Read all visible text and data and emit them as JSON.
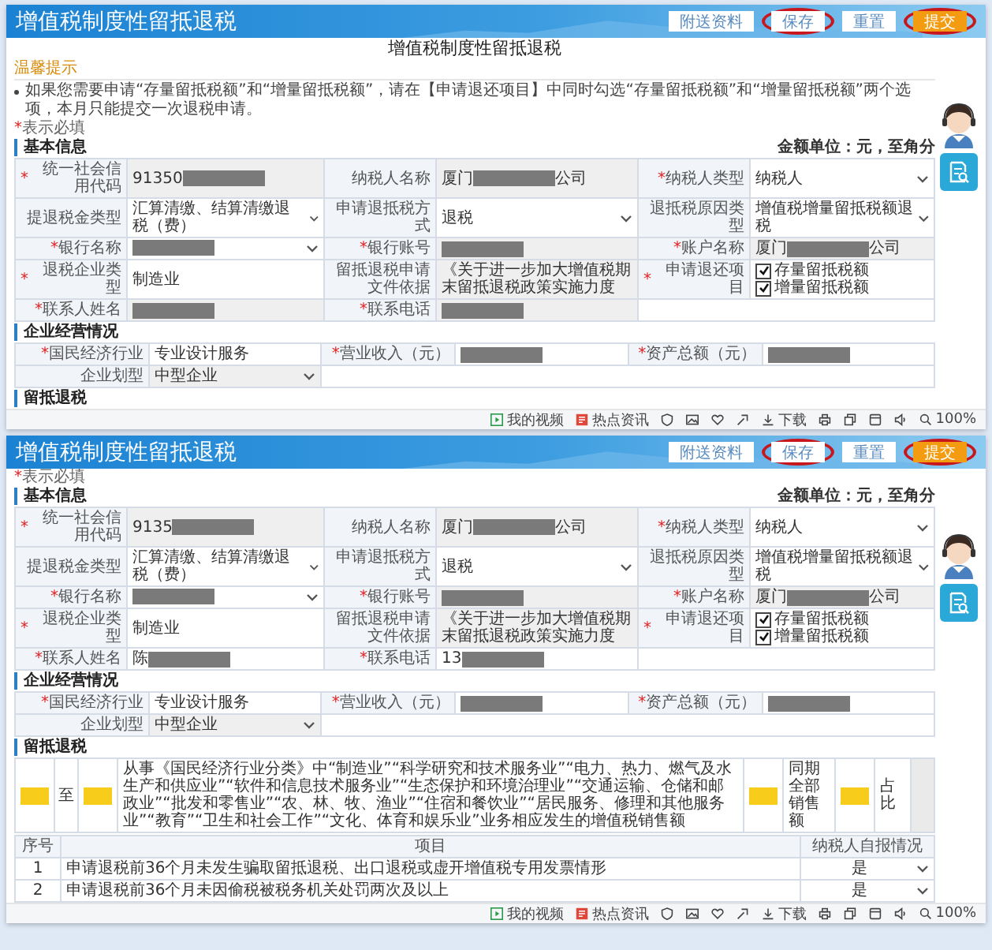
{
  "panels": [
    {
      "header": {
        "title": "增值税制度性留抵退税",
        "buttons": [
          {
            "label": "附送资料",
            "kind": "plain",
            "circled": false
          },
          {
            "label": "保存",
            "kind": "plain",
            "circled": true
          },
          {
            "label": "重置",
            "kind": "plain",
            "circled": false
          },
          {
            "label": "提交",
            "kind": "primary",
            "circled": true
          }
        ]
      },
      "page_title": "增值税制度性留抵退税",
      "tip": {
        "title": "温馨提示",
        "text": "如果您需要申请“存量留抵税额”和“增量留抵税额”，请在【申请退还项目】中同时勾选“存量留抵税额”和“增量留抵税额”两个选项，本月只能提交一次退税申请。"
      },
      "required_note": {
        "mark": "*",
        "text": "表示必填"
      },
      "sections": [
        {
          "title": "基本信息",
          "unit": "金额单位：元，至角分",
          "kind": "basic",
          "rows": [
            {
              "cells": [
                {
                  "kind": "label",
                  "required_mark": "*",
                  "text": "统一社会信用代码"
                },
                {
                  "kind": "input",
                  "text": "91350",
                  "redacted": true,
                  "disabled": true
                },
                {
                  "kind": "label",
                  "text": "纳税人名称"
                },
                {
                  "kind": "input",
                  "text": "厦门",
                  "redacted": true,
                  "suffix": "公司",
                  "disabled": true
                },
                {
                  "kind": "label",
                  "required_mark": "*",
                  "text": "纳税人类型"
                },
                {
                  "kind": "select",
                  "text": "纳税人"
                }
              ]
            },
            {
              "cells": [
                {
                  "kind": "label",
                  "text": "提退税金类型"
                },
                {
                  "kind": "select",
                  "text": "汇算清缴、结算清缴退税（费）"
                },
                {
                  "kind": "label",
                  "text": "申请退抵税方式"
                },
                {
                  "kind": "select",
                  "text": "退税"
                },
                {
                  "kind": "label",
                  "text": "退抵税原因类型"
                },
                {
                  "kind": "select",
                  "text": "增值税增量留抵税额退税"
                }
              ]
            },
            {
              "cells": [
                {
                  "kind": "label",
                  "required_mark": "*",
                  "text": "银行名称"
                },
                {
                  "kind": "select",
                  "redacted": true
                },
                {
                  "kind": "label",
                  "required_mark": "*",
                  "text": "银行账号"
                },
                {
                  "kind": "input",
                  "redacted": true,
                  "disabled": true
                },
                {
                  "kind": "label",
                  "required_mark": "*",
                  "text": "账户名称"
                },
                {
                  "kind": "input",
                  "text": "厦门",
                  "redacted": true,
                  "suffix": "公司",
                  "disabled": true
                }
              ]
            },
            {
              "cells": [
                {
                  "kind": "label",
                  "required_mark": "*",
                  "text": "退税企业类型"
                },
                {
                  "kind": "input",
                  "text": "制造业",
                  "disabled": false
                },
                {
                  "kind": "label",
                  "text": "留抵退税申请文件依据"
                },
                {
                  "kind": "input",
                  "text": "《关于进一步加大增值税期末留抵退税政策实施力度",
                  "disabled": true
                },
                {
                  "kind": "label",
                  "required_mark": "*",
                  "text": "申请退还项目"
                },
                {
                  "kind": "checks",
                  "options": [
                    {
                      "label": "存量留抵税额",
                      "checked": true
                    },
                    {
                      "label": "增量留抵税额",
                      "checked": true
                    }
                  ]
                }
              ]
            },
            {
              "cells": [
                {
                  "kind": "label",
                  "required_mark": "*",
                  "text": "联系人姓名"
                },
                {
                  "kind": "input",
                  "redacted": true,
                  "disabled": true
                },
                {
                  "kind": "label",
                  "required_mark": "*",
                  "text": "联系电话"
                },
                {
                  "kind": "input",
                  "redacted": true,
                  "disabled": true
                },
                {
                  "kind": "empty"
                }
              ]
            }
          ]
        },
        {
          "title": "企业经营情况",
          "kind": "business",
          "rows": [
            {
              "cells": [
                {
                  "kind": "label",
                  "required_mark": "*",
                  "text": "国民经济行业"
                },
                {
                  "kind": "input",
                  "text": "专业设计服务",
                  "disabled": false
                },
                {
                  "kind": "label",
                  "required_mark": "*",
                  "text": "营业收入（元）"
                },
                {
                  "kind": "input",
                  "redacted": true,
                  "disabled": false
                },
                {
                  "kind": "label",
                  "required_mark": "*",
                  "text": "资产总额（元）"
                },
                {
                  "kind": "input",
                  "redacted": true,
                  "disabled": false
                }
              ]
            },
            {
              "cells": [
                {
                  "kind": "label",
                  "text": "企业划型"
                },
                {
                  "kind": "select",
                  "text": "中型企业",
                  "disabled": true
                },
                {
                  "kind": "empty"
                }
              ]
            }
          ]
        },
        {
          "title": "留抵退税",
          "kind": "refund"
        }
      ],
      "status_bar": {
        "video": "我的视频",
        "news": "热点资讯",
        "download": "下载",
        "zoom": "100%"
      }
    },
    {
      "header": {
        "title": "增值税制度性留抵退税",
        "buttons": [
          {
            "label": "附送资料",
            "kind": "plain",
            "circled": false
          },
          {
            "label": "保存",
            "kind": "plain",
            "circled": true
          },
          {
            "label": "重置",
            "kind": "plain",
            "circled": false
          },
          {
            "label": "提交",
            "kind": "primary",
            "circled": true
          }
        ]
      },
      "required_note": {
        "mark": "*",
        "text": "表示必填"
      },
      "sections": [
        {
          "title": "基本信息",
          "unit": "金额单位：元，至角分",
          "kind": "basic",
          "rows": [
            {
              "cells": [
                {
                  "kind": "label",
                  "required_mark": "*",
                  "text": "统一社会信用代码"
                },
                {
                  "kind": "input",
                  "text": "9135",
                  "redacted": true,
                  "disabled": true
                },
                {
                  "kind": "label",
                  "text": "纳税人名称"
                },
                {
                  "kind": "input",
                  "text": "厦门",
                  "redacted": true,
                  "suffix": "公司",
                  "disabled": true
                },
                {
                  "kind": "label",
                  "required_mark": "*",
                  "text": "纳税人类型"
                },
                {
                  "kind": "select",
                  "text": "纳税人"
                }
              ]
            },
            {
              "cells": [
                {
                  "kind": "label",
                  "text": "提退税金类型"
                },
                {
                  "kind": "select",
                  "text": "汇算清缴、结算清缴退税（费）"
                },
                {
                  "kind": "label",
                  "text": "申请退抵税方式"
                },
                {
                  "kind": "select",
                  "text": "退税"
                },
                {
                  "kind": "label",
                  "text": "退抵税原因类型"
                },
                {
                  "kind": "select",
                  "text": "增值税增量留抵税额退税"
                }
              ]
            },
            {
              "cells": [
                {
                  "kind": "label",
                  "required_mark": "*",
                  "text": "银行名称"
                },
                {
                  "kind": "select",
                  "redacted": true
                },
                {
                  "kind": "label",
                  "required_mark": "*",
                  "text": "银行账号"
                },
                {
                  "kind": "input",
                  "redacted": true,
                  "disabled": true
                },
                {
                  "kind": "label",
                  "required_mark": "*",
                  "text": "账户名称"
                },
                {
                  "kind": "input",
                  "text": "厦门",
                  "redacted": true,
                  "suffix": "公司",
                  "disabled": true
                }
              ]
            },
            {
              "cells": [
                {
                  "kind": "label",
                  "required_mark": "*",
                  "text": "退税企业类型"
                },
                {
                  "kind": "input",
                  "text": "制造业",
                  "disabled": false
                },
                {
                  "kind": "label",
                  "text": "留抵退税申请文件依据"
                },
                {
                  "kind": "input",
                  "text": "《关于进一步加大增值税期末留抵退税政策实施力度",
                  "disabled": true
                },
                {
                  "kind": "label",
                  "required_mark": "*",
                  "text": "申请退还项目"
                },
                {
                  "kind": "checks",
                  "options": [
                    {
                      "label": "存量留抵税额",
                      "checked": true
                    },
                    {
                      "label": "增量留抵税额",
                      "checked": true
                    }
                  ]
                }
              ]
            },
            {
              "cells": [
                {
                  "kind": "label",
                  "required_mark": "*",
                  "text": "联系人姓名"
                },
                {
                  "kind": "input",
                  "text": "陈",
                  "redacted": true,
                  "disabled": false
                },
                {
                  "kind": "label",
                  "required_mark": "*",
                  "text": "联系电话"
                },
                {
                  "kind": "input",
                  "text": "13",
                  "redacted": true,
                  "disabled": false
                },
                {
                  "kind": "empty"
                }
              ]
            }
          ]
        },
        {
          "title": "企业经营情况",
          "kind": "business",
          "rows": [
            {
              "cells": [
                {
                  "kind": "label",
                  "required_mark": "*",
                  "text": "国民经济行业"
                },
                {
                  "kind": "input",
                  "text": "专业设计服务",
                  "disabled": false
                },
                {
                  "kind": "label",
                  "required_mark": "*",
                  "text": "营业收入（元）"
                },
                {
                  "kind": "input",
                  "redacted": true,
                  "disabled": false
                },
                {
                  "kind": "label",
                  "required_mark": "*",
                  "text": "资产总额（元）"
                },
                {
                  "kind": "input",
                  "redacted": true,
                  "disabled": false
                }
              ]
            },
            {
              "cells": [
                {
                  "kind": "label",
                  "text": "企业划型"
                },
                {
                  "kind": "select",
                  "text": "中型企业",
                  "disabled": true
                },
                {
                  "kind": "empty"
                }
              ]
            }
          ]
        },
        {
          "title": "留抵退税",
          "kind": "refund",
          "ratio_row": [
            {
              "kind": "highlight"
            },
            {
              "kind": "text",
              "text": "至"
            },
            {
              "kind": "highlight"
            },
            {
              "kind": "text",
              "text": "从事《国民经济行业分类》中“制造业”“科学研究和技术服务业”“电力、热力、燃气及水生产和供应业”“软件和信息技术服务业”“生态保护和环境治理业”“交通运输、仓储和邮政业”“批发和零售业”“农、林、牧、渔业”“住宿和餐饮业”“居民服务、修理和其他服务业”“教育”“卫生和社会工作”“文化、体育和娱乐业”业务相应发生的增值税销售额"
            },
            {
              "kind": "highlight"
            },
            {
              "kind": "text",
              "text": "同期全部销售额"
            },
            {
              "kind": "highlight"
            },
            {
              "kind": "text",
              "text": "占比"
            },
            {
              "kind": "blank"
            }
          ],
          "table": {
            "columns": [
              "序号",
              "项目",
              "纳税人自报情况"
            ],
            "rows": [
              {
                "no": "1",
                "item": "申请退税前36个月未发生骗取留抵退税、出口退税或虚开增值税专用发票情形",
                "value": "是"
              },
              {
                "no": "2",
                "item": "申请退税前36个月未因偷税被税务机关处罚两次及以上",
                "value": "是"
              }
            ]
          }
        }
      ],
      "status_bar": {
        "video": "我的视频",
        "news": "热点资讯",
        "download": "下载",
        "zoom": "100%"
      }
    }
  ]
}
